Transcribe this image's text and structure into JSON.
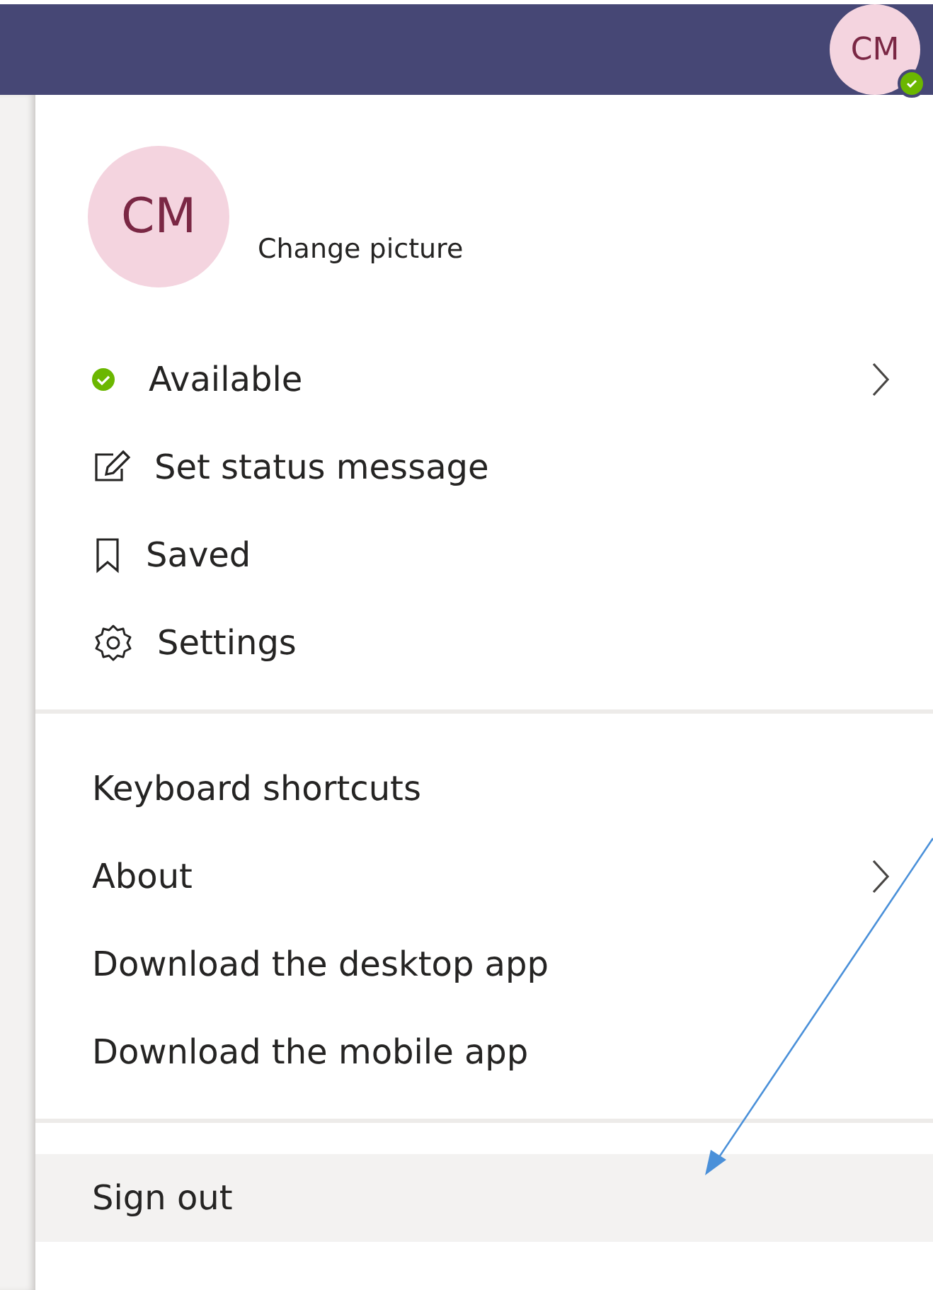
{
  "header": {
    "avatar": {
      "initials": "CM",
      "online": true
    }
  },
  "profile": {
    "initials": "CM",
    "change_picture": "Change picture"
  },
  "menu_sections": [
    {
      "items": [
        {
          "label": "Available",
          "kind": "status",
          "has_submenu": true,
          "highlighted": false
        },
        {
          "label": "Set status message",
          "kind": "edit",
          "has_submenu": false,
          "highlighted": false
        },
        {
          "label": "Saved",
          "kind": "bookmark",
          "has_submenu": false,
          "highlighted": false
        },
        {
          "label": "Settings",
          "kind": "settings",
          "has_submenu": false,
          "highlighted": false
        }
      ]
    },
    {
      "items": [
        {
          "label": "Keyboard shortcuts",
          "kind": "plain",
          "has_submenu": false,
          "highlighted": false
        },
        {
          "label": "About",
          "kind": "plain",
          "has_submenu": true,
          "highlighted": false
        },
        {
          "label": "Download the desktop app",
          "kind": "plain",
          "has_submenu": false,
          "highlighted": false
        },
        {
          "label": "Download the mobile app",
          "kind": "plain",
          "has_submenu": false,
          "highlighted": false
        }
      ]
    },
    {
      "items": [
        {
          "label": "Sign out",
          "kind": "plain",
          "has_submenu": false,
          "highlighted": true
        }
      ]
    }
  ]
}
